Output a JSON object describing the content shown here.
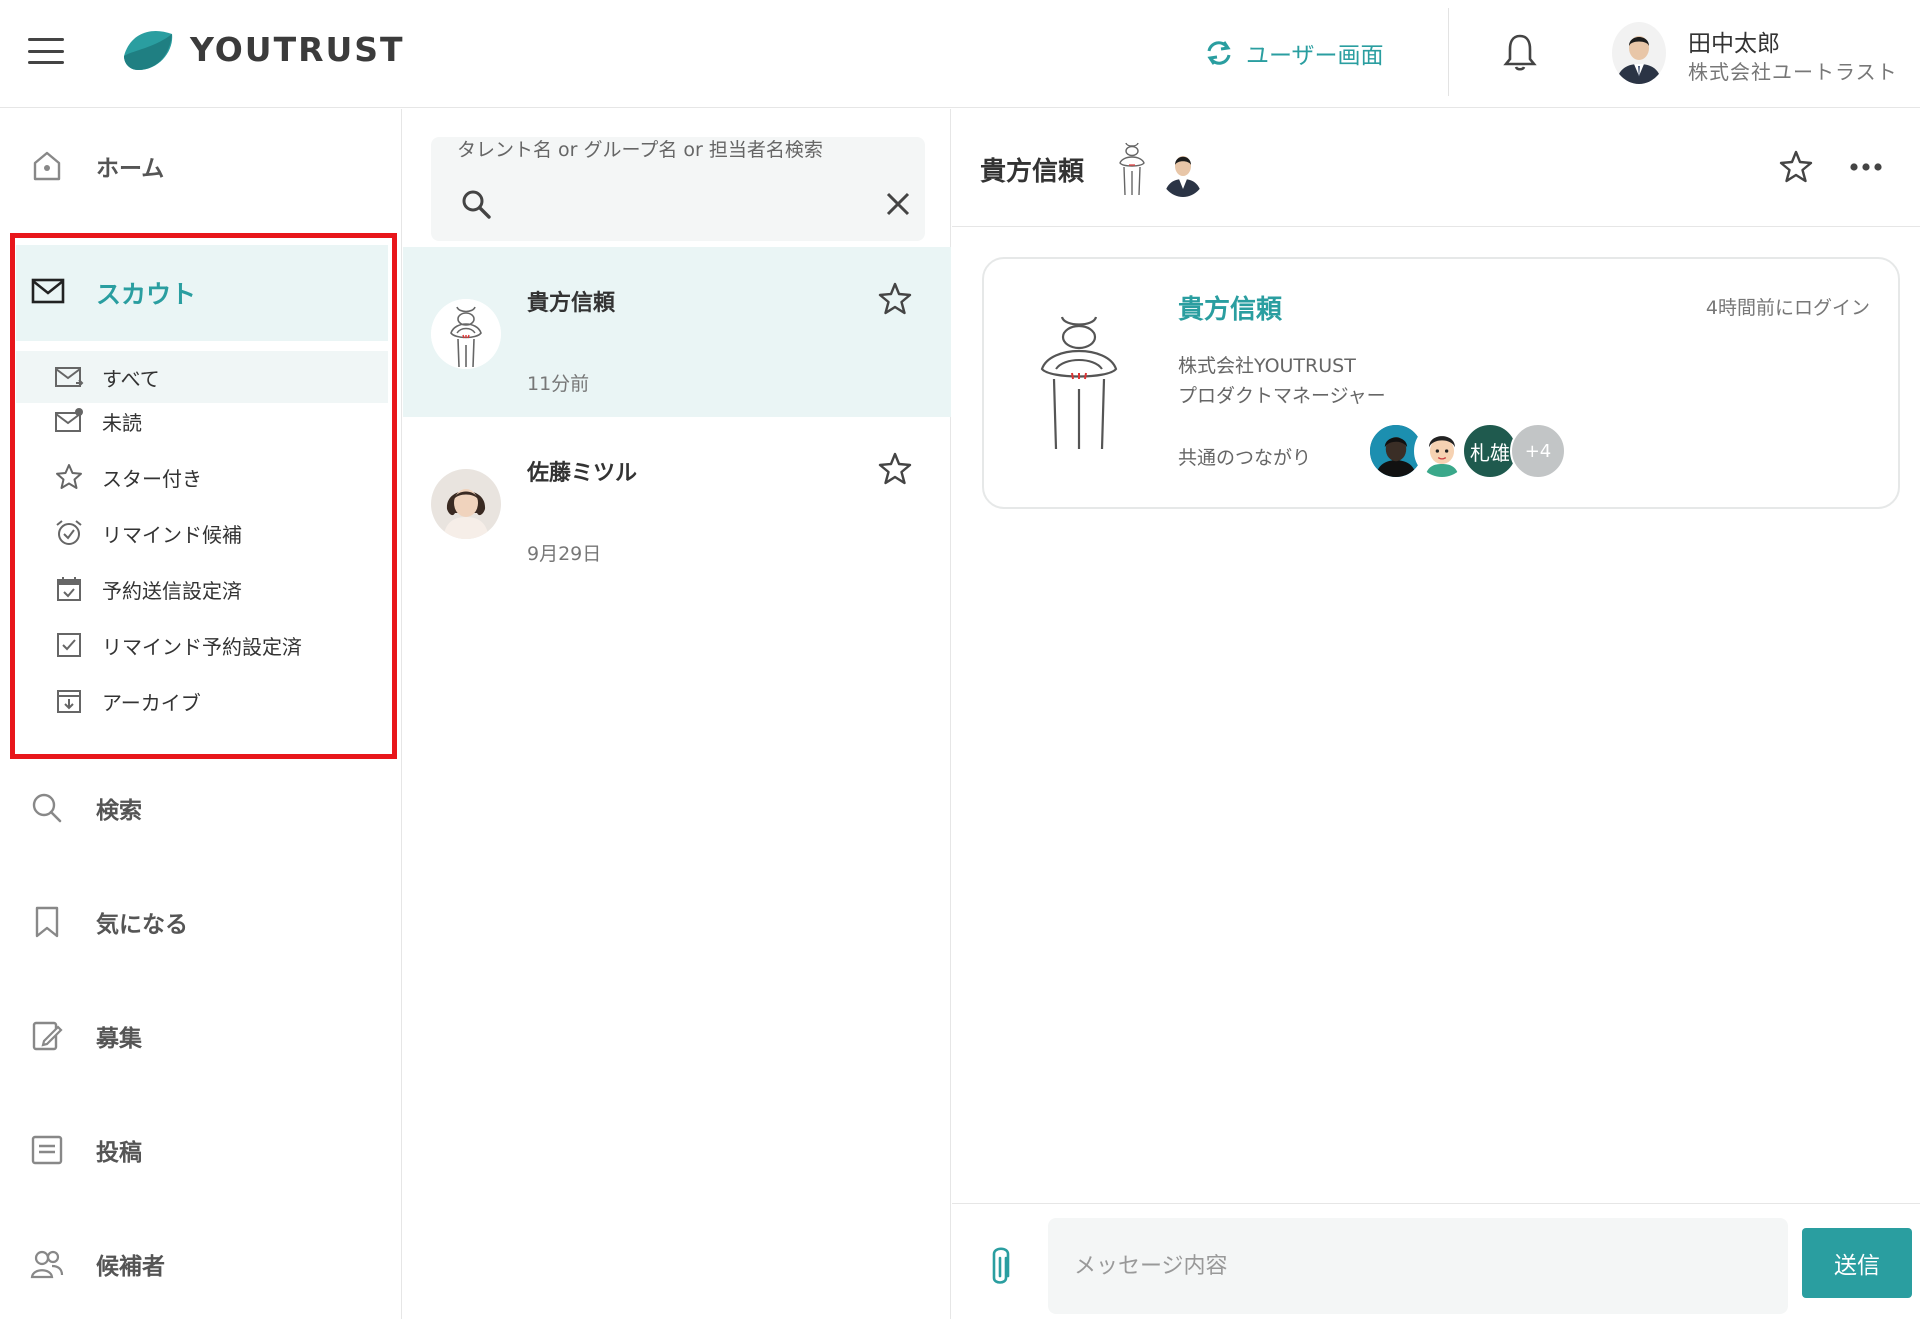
{
  "header": {
    "logo_text": "YOUTRUST",
    "switch_label": "ユーザー画面",
    "user_name": "田中太郎",
    "user_company": "株式会社ユートラスト"
  },
  "sidebar": {
    "home": "ホーム",
    "scout": "スカウト",
    "scout_sub": [
      {
        "label": "すべて",
        "icon": "mail-all-icon"
      },
      {
        "label": "未読",
        "icon": "mail-unread-icon"
      },
      {
        "label": "スター付き",
        "icon": "star-icon"
      },
      {
        "label": "リマインド候補",
        "icon": "alarm-icon"
      },
      {
        "label": "予約送信設定済",
        "icon": "calendar-check-icon"
      },
      {
        "label": "リマインド予約設定済",
        "icon": "checkbox-icon"
      },
      {
        "label": "アーカイブ",
        "icon": "archive-icon"
      }
    ],
    "search": "検索",
    "bookmark": "気になる",
    "recruit": "募集",
    "post": "投稿",
    "candidates": "候補者"
  },
  "list": {
    "search_placeholder": "タレント名 or グループ名 or 担当者名検索",
    "conversations": [
      {
        "name": "貴方信頼",
        "time": "11分前"
      },
      {
        "name": "佐藤ミツル",
        "time": "9月29日"
      }
    ]
  },
  "chat": {
    "title": "貴方信頼",
    "profile": {
      "name": "貴方信頼",
      "last_login": "4時間前にログイン",
      "company": "株式会社YOUTRUST",
      "role": "プロダクトマネージャー",
      "mutual_label": "共通のつながり",
      "mutual_extra": "+4",
      "mutual_text_avatar": "札雄"
    },
    "composer_placeholder": "メッセージ内容",
    "send_label": "送信"
  },
  "colors": {
    "accent": "#2a9ea0",
    "highlight": "#e8161b",
    "selected_bg": "#eaf5f5"
  }
}
